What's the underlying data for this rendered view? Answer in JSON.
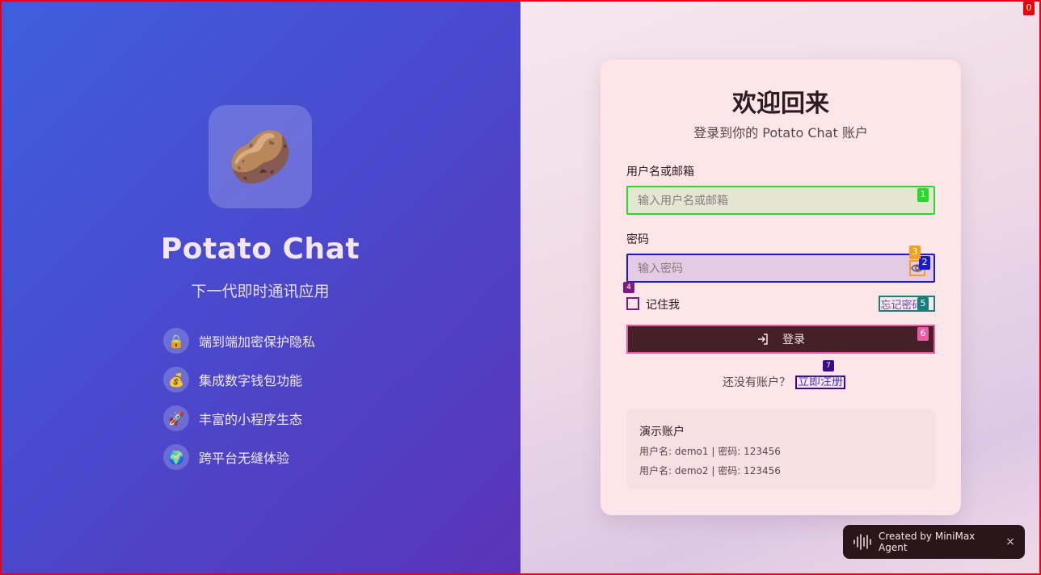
{
  "brand": {
    "name": "Potato Chat",
    "tagline": "下一代即时通讯应用",
    "logo_emoji": "🥔",
    "features": [
      {
        "icon": "🔒",
        "icon_name": "lock-icon",
        "label": "端到端加密保护隐私"
      },
      {
        "icon": "💰",
        "icon_name": "money-bag-icon",
        "label": "集成数字钱包功能"
      },
      {
        "icon": "🚀",
        "icon_name": "rocket-icon",
        "label": "丰富的小程序生态"
      },
      {
        "icon": "🌍",
        "icon_name": "globe-icon",
        "label": "跨平台无缝体验"
      }
    ]
  },
  "login": {
    "title": "欢迎回来",
    "subtitle": "登录到你的 Potato Chat 账户",
    "username_label": "用户名或邮箱",
    "username_placeholder": "输入用户名或邮箱",
    "password_label": "密码",
    "password_placeholder": "输入密码",
    "remember_label": "记住我",
    "forgot_label": "忘记密码？",
    "submit_label": "登录",
    "no_account_text": "还没有账户？",
    "signup_label": "立即注册"
  },
  "demo": {
    "title": "演示账户",
    "accounts": [
      "用户名: demo1 | 密码: 123456",
      "用户名: demo2 | 密码: 123456"
    ]
  },
  "toast": {
    "text": "Created by MiniMax Agent",
    "close": "×"
  },
  "overlay_tags": [
    "0",
    "1",
    "2",
    "3",
    "4",
    "5",
    "6",
    "7"
  ],
  "colors": {
    "left_gradient_start": "#3e5fde",
    "left_gradient_end": "#5a34b8",
    "card_bg": "#fde5e8",
    "button_bg": "#452027"
  }
}
